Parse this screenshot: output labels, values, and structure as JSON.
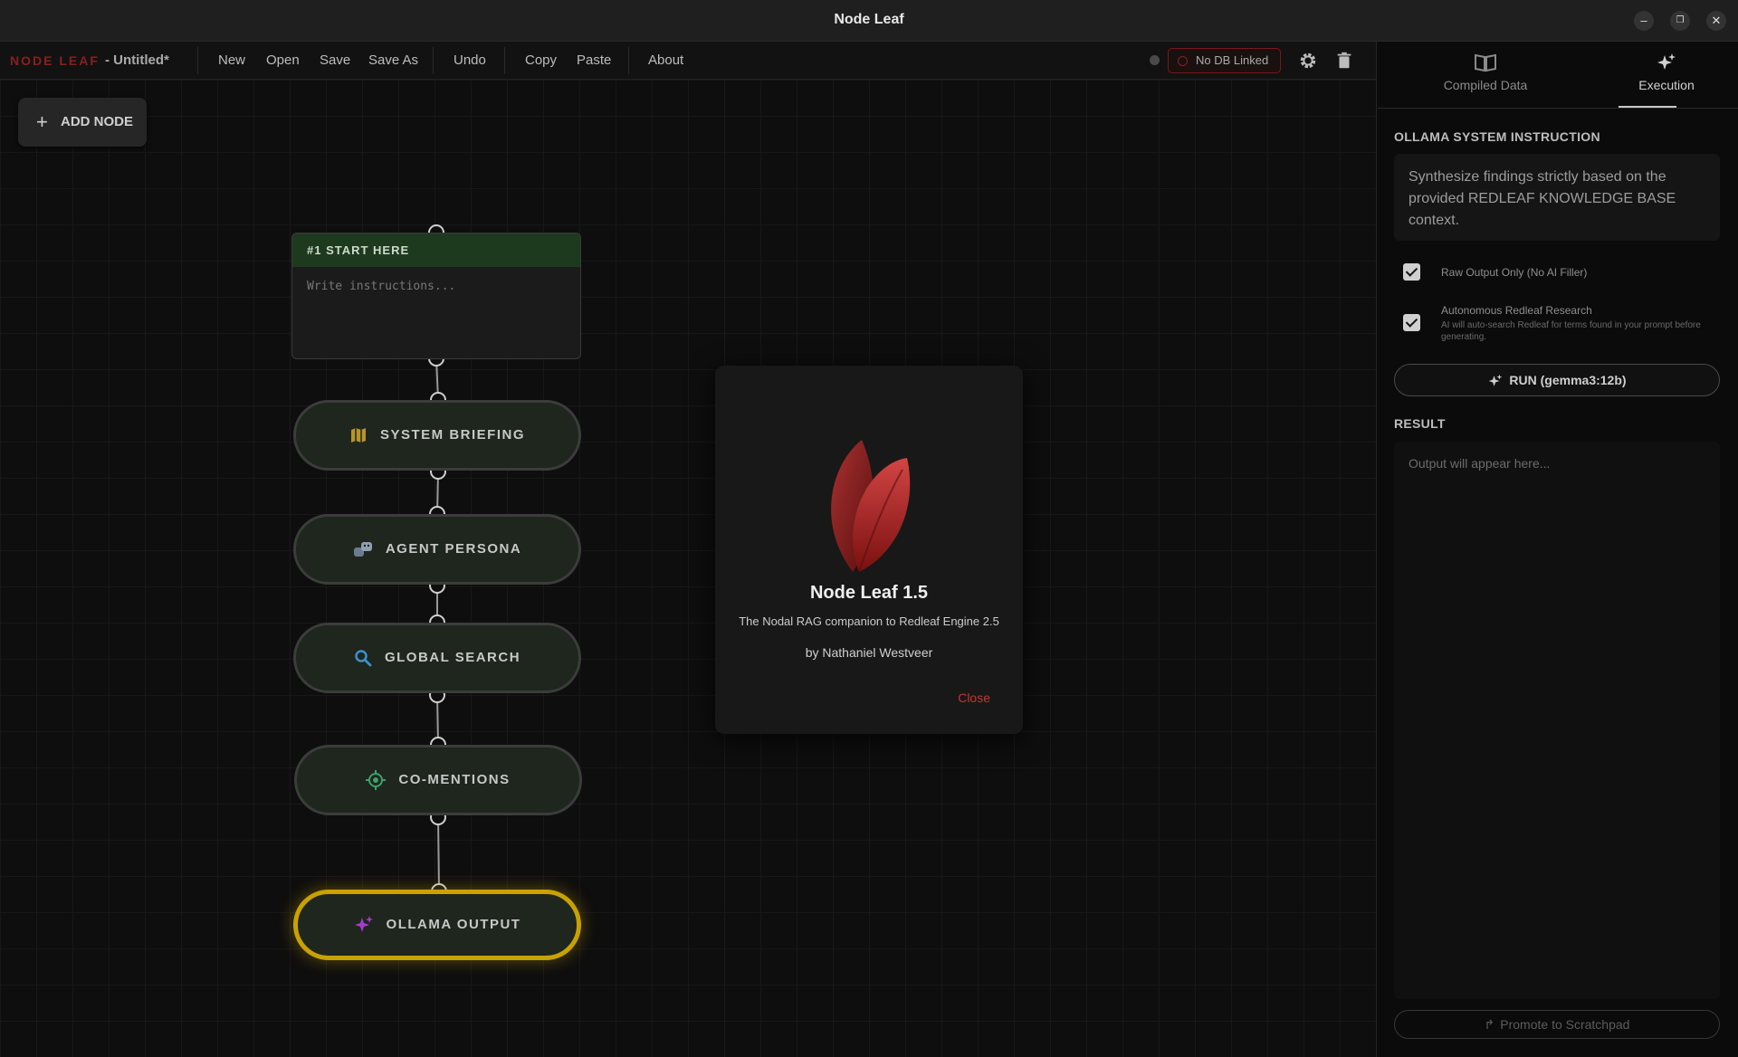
{
  "window": {
    "title": "Node Leaf"
  },
  "menubar": {
    "brand": "NODE LEAF",
    "doc_name": "- Untitled*",
    "items": [
      "New",
      "Open",
      "Save",
      "Save As",
      "Undo",
      "Copy",
      "Paste",
      "About"
    ],
    "db_status": "No DB Linked"
  },
  "canvas": {
    "add_node_label": "ADD NODE",
    "start_node": {
      "header": "#1 START HERE",
      "placeholder": "Write instructions..."
    },
    "nodes": [
      {
        "label": "SYSTEM BRIEFING",
        "icon": "map-icon",
        "color": "#b8942a"
      },
      {
        "label": "AGENT PERSONA",
        "icon": "persona-icon",
        "color": "#6a7c92"
      },
      {
        "label": "GLOBAL SEARCH",
        "icon": "search-icon",
        "color": "#3e8fc9"
      },
      {
        "label": "CO-MENTIONS",
        "icon": "target-icon",
        "color": "#3fa06a"
      },
      {
        "label": "OLLAMA OUTPUT",
        "icon": "sparkles-icon",
        "color": "#a63ad0",
        "active": true
      }
    ]
  },
  "modal": {
    "title": "Node Leaf 1.5",
    "subtitle": "The Nodal RAG companion to Redleaf Engine 2.5",
    "author": "by Nathaniel Westveer",
    "close_label": "Close"
  },
  "panel": {
    "tabs": [
      {
        "label": "Compiled Data",
        "icon": "book-icon"
      },
      {
        "label": "Execution",
        "icon": "sparkles-icon",
        "active": true
      }
    ],
    "system_instruction_label": "OLLAMA SYSTEM INSTRUCTION",
    "system_instruction": "Synthesize findings strictly based on the provided REDLEAF KNOWLEDGE BASE context.",
    "options": [
      {
        "label": "Raw Output Only (No AI Filler)",
        "checked": true
      },
      {
        "label": "Autonomous Redleaf Research",
        "description": "AI will auto-search Redleaf for terms found in your prompt before generating.",
        "checked": true
      }
    ],
    "run_label": "RUN (gemma3:12b)",
    "result_label": "RESULT",
    "result_placeholder": "Output will appear here...",
    "promote_label": "Promote to Scratchpad"
  }
}
